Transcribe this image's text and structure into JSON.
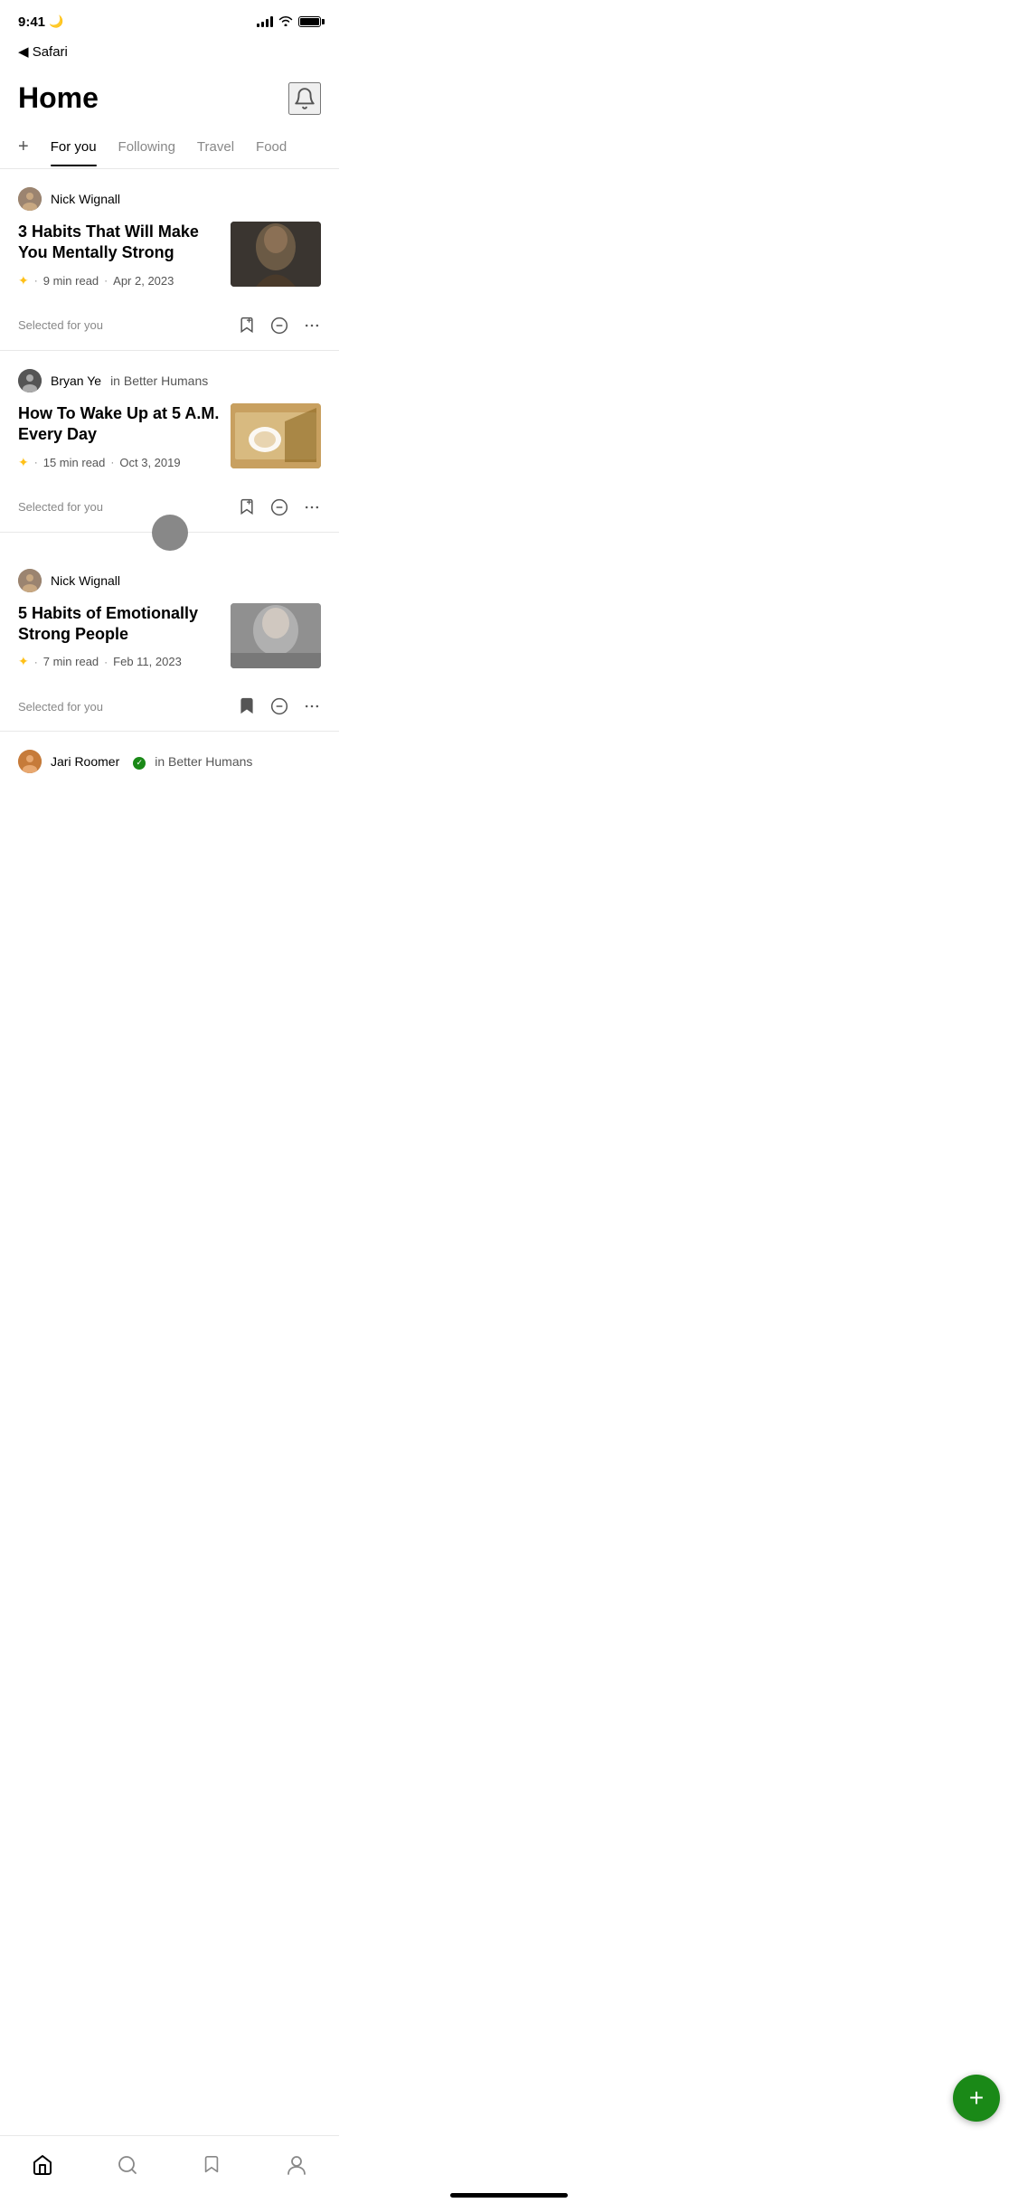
{
  "statusBar": {
    "time": "9:41",
    "moonIcon": "🌙",
    "safariBack": "◀ Safari"
  },
  "header": {
    "title": "Home",
    "bellLabel": "notifications"
  },
  "tabs": {
    "addLabel": "+",
    "items": [
      {
        "id": "for-you",
        "label": "For you",
        "active": true
      },
      {
        "id": "following",
        "label": "Following",
        "active": false
      },
      {
        "id": "travel",
        "label": "Travel",
        "active": false
      },
      {
        "id": "food",
        "label": "Food",
        "active": false
      }
    ]
  },
  "articles": [
    {
      "id": "article-1",
      "author": "Nick Wignall",
      "publication": null,
      "title": "3 Habits That Will Make You Mentally Strong",
      "readTime": "9 min read",
      "date": "Apr 2, 2023",
      "selectedForYou": "Selected for you",
      "bookmarked": false
    },
    {
      "id": "article-2",
      "author": "Bryan Ye",
      "publication": "Better Humans",
      "title": "How To Wake Up at 5 A.M. Every Day",
      "readTime": "15 min read",
      "date": "Oct 3, 2019",
      "selectedForYou": "Selected for you",
      "bookmarked": false
    },
    {
      "id": "article-3",
      "author": "Nick Wignall",
      "publication": null,
      "title": "5 Habits of Emotionally Strong People",
      "readTime": "7 min read",
      "date": "Feb 11, 2023",
      "selectedForYou": "Selected for you",
      "bookmarked": true
    },
    {
      "id": "article-4",
      "author": "Jari Roomer",
      "publication": "Better Humans",
      "title": "",
      "readTime": "",
      "date": "",
      "selectedForYou": "",
      "bookmarked": false
    }
  ],
  "fab": {
    "label": "+"
  },
  "bottomNav": {
    "items": [
      {
        "id": "home",
        "icon": "home"
      },
      {
        "id": "search",
        "icon": "search"
      },
      {
        "id": "bookmarks",
        "icon": "bookmark"
      },
      {
        "id": "profile",
        "icon": "profile"
      }
    ]
  },
  "inLabel": "in",
  "dotSeparator": "·"
}
